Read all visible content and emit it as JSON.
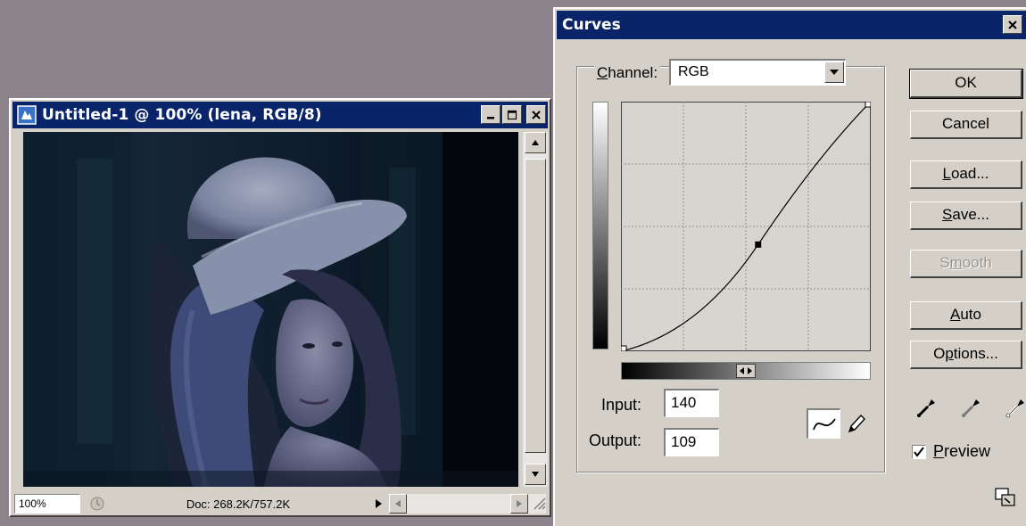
{
  "doc_window": {
    "title": "Untitled-1 @ 100% (lena, RGB/8)",
    "zoom": "100%",
    "doc_size": "Doc: 268.2K/757.2K"
  },
  "curves": {
    "title": "Curves",
    "channel_label": "Channel:",
    "channel_value": "RGB",
    "input_label": "Input:",
    "input_value": "140",
    "output_label": "Output:",
    "output_value": "109",
    "buttons": {
      "ok": "OK",
      "cancel": "Cancel",
      "load": "Load...",
      "save": "Save...",
      "smooth": "Smooth",
      "auto": "Auto",
      "options": "Options..."
    },
    "preview_label": "Preview",
    "preview_checked": true,
    "curve_points": [
      [
        0,
        0
      ],
      [
        140,
        109
      ],
      [
        255,
        255
      ]
    ]
  },
  "icons": {
    "app": "photoshop-doc-icon",
    "minimize": "minimize-icon",
    "maximize": "maximize-icon",
    "close": "close-icon",
    "curve_tool": "curve-tool-icon",
    "pencil": "pencil-icon",
    "eyedroppers": [
      "black-eyedropper-icon",
      "gray-eyedropper-icon",
      "white-eyedropper-icon"
    ]
  },
  "colors": {
    "titlebar": "#0a246a",
    "chrome": "#d4d0c8",
    "desktop": "#8c838b"
  }
}
